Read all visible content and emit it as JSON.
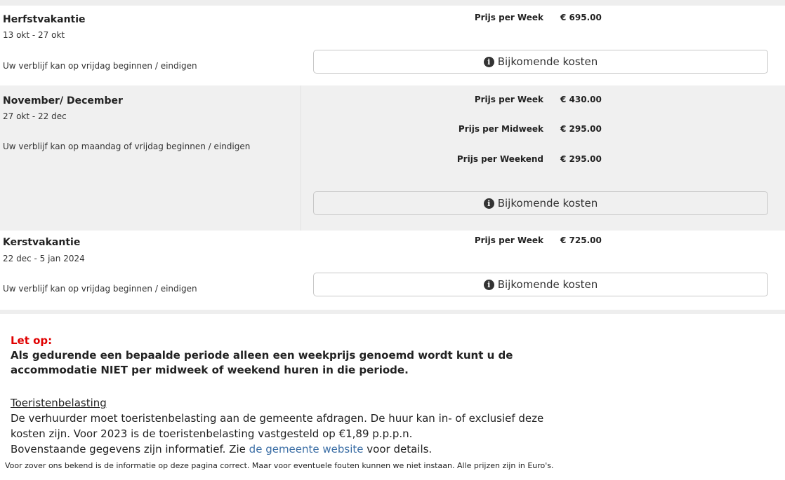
{
  "periods": [
    {
      "name": "Herfstvakantie",
      "dates": "13 okt - 27 okt",
      "note": "Uw verblijf kan op vrijdag beginnen / eindigen",
      "prices": [
        {
          "label": "Prijs per Week",
          "value": "€ 695.00"
        }
      ],
      "button_label": "Bijkomende kosten"
    },
    {
      "name": "November/ December",
      "dates": "27 okt - 22 dec",
      "note": "Uw verblijf kan op maandag of vrijdag beginnen / eindigen",
      "prices": [
        {
          "label": "Prijs per Week",
          "value": "€ 430.00"
        },
        {
          "label": "Prijs per Midweek",
          "value": "€ 295.00"
        },
        {
          "label": "Prijs per Weekend",
          "value": "€ 295.00"
        }
      ],
      "button_label": "Bijkomende kosten"
    },
    {
      "name": "Kerstvakantie",
      "dates": "22 dec - 5 jan 2024",
      "note": "Uw verblijf kan op vrijdag beginnen / eindigen",
      "prices": [
        {
          "label": "Prijs per Week",
          "value": "€ 725.00"
        }
      ],
      "button_label": "Bijkomende kosten"
    }
  ],
  "notice": {
    "heading": "Let op:",
    "body": "Als gedurende een bepaalde periode alleen een weekprijs genoemd wordt kunt u de accommodatie NIET per midweek of weekend huren in die periode."
  },
  "tax": {
    "title": "Toeristenbelasting",
    "line1": "De verhuurder moet toeristenbelasting aan de gemeente afdragen. De huur kan in- of exclusief deze kosten zijn. Voor 2023 is de toeristenbelasting vastgesteld op €1,89 p.p.p.n.",
    "line2_prefix": "Bovenstaande gegevens zijn informatief. Zie",
    "link_text": "de gemeente website",
    "line2_suffix": "voor details."
  },
  "disclaimer": "Voor zover ons bekend is de informatie op deze pagina correct. Maar voor eventuele fouten kunnen we niet instaan. Alle prijzen zijn in Euro's.",
  "colors": {
    "warning": "#e00000",
    "link": "#3b6ea5",
    "row_alt": "#f0f0f0"
  },
  "icons": {
    "info": "info-circle-icon"
  }
}
